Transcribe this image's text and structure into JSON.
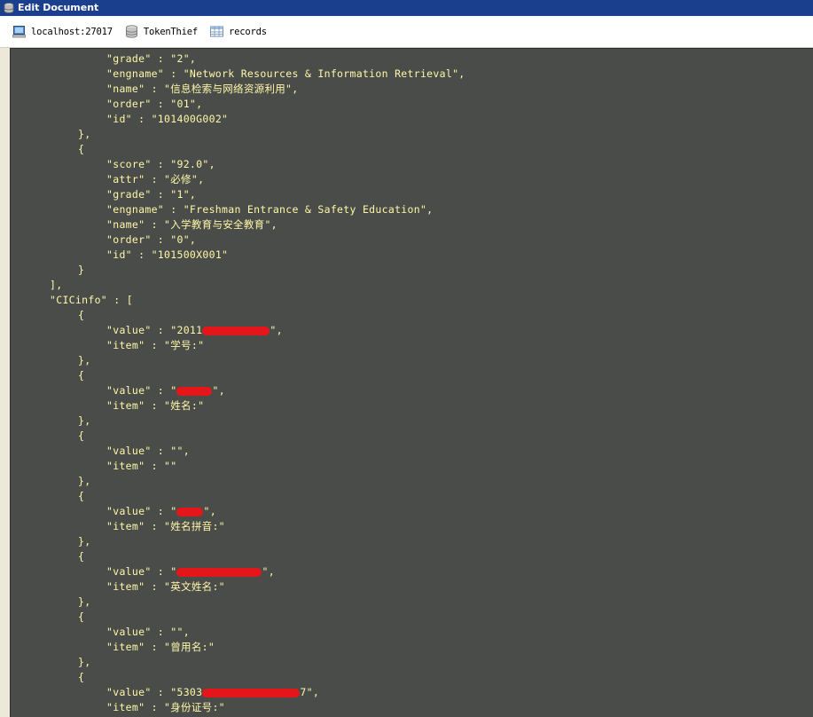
{
  "window": {
    "title": "Edit Document"
  },
  "breadcrumb": [
    {
      "label": "localhost:27017",
      "icon": "server-icon"
    },
    {
      "label": "TokenThief",
      "icon": "database-icon"
    },
    {
      "label": "records",
      "icon": "table-icon"
    }
  ],
  "document": {
    "lines": [
      {
        "indent": 12,
        "key": "\"grade\"",
        "value": "\"2\","
      },
      {
        "indent": 12,
        "key": "\"engname\"",
        "value": "\"Network Resources & Information Retrieval\","
      },
      {
        "indent": 12,
        "key": "\"name\"",
        "value": "\"信息检索与网络资源利用\","
      },
      {
        "indent": 12,
        "key": "\"order\"",
        "value": "\"01\","
      },
      {
        "indent": 12,
        "key": "\"id\"",
        "value": "\"101400G002\""
      },
      {
        "indent": 8,
        "text": "},"
      },
      {
        "indent": 8,
        "text": "{"
      },
      {
        "indent": 12,
        "key": "\"score\"",
        "value": "\"92.0\","
      },
      {
        "indent": 12,
        "key": "\"attr\"",
        "value": "\"必修\","
      },
      {
        "indent": 12,
        "key": "\"grade\"",
        "value": "\"1\","
      },
      {
        "indent": 12,
        "key": "\"engname\"",
        "value": "\"Freshman Entrance & Safety Education\","
      },
      {
        "indent": 12,
        "key": "\"name\"",
        "value": "\"入学教育与安全教育\","
      },
      {
        "indent": 12,
        "key": "\"order\"",
        "value": "\"0\","
      },
      {
        "indent": 12,
        "key": "\"id\"",
        "value": "\"101500X001\""
      },
      {
        "indent": 8,
        "text": "}"
      },
      {
        "indent": 4,
        "text": "],"
      },
      {
        "indent": 4,
        "key": "\"CICinfo\"",
        "value": "["
      },
      {
        "indent": 8,
        "text": "{"
      },
      {
        "indent": 12,
        "key": "\"value\"",
        "value": "\"2011",
        "redact": 76,
        "after": "\","
      },
      {
        "indent": 12,
        "key": "\"item\"",
        "value": "\"学号:\""
      },
      {
        "indent": 8,
        "text": "},"
      },
      {
        "indent": 8,
        "text": "{"
      },
      {
        "indent": 12,
        "key": "\"value\"",
        "value": "\"",
        "redact": 40,
        "after": "\","
      },
      {
        "indent": 12,
        "key": "\"item\"",
        "value": "\"姓名:\""
      },
      {
        "indent": 8,
        "text": "},"
      },
      {
        "indent": 8,
        "text": "{"
      },
      {
        "indent": 12,
        "key": "\"value\"",
        "value": "\"\","
      },
      {
        "indent": 12,
        "key": "\"item\"",
        "value": "\"\""
      },
      {
        "indent": 8,
        "text": "},"
      },
      {
        "indent": 8,
        "text": "{"
      },
      {
        "indent": 12,
        "key": "\"value\"",
        "value": "\"",
        "redact": 30,
        "after": "\","
      },
      {
        "indent": 12,
        "key": "\"item\"",
        "value": "\"姓名拼音:\""
      },
      {
        "indent": 8,
        "text": "},"
      },
      {
        "indent": 8,
        "text": "{"
      },
      {
        "indent": 12,
        "key": "\"value\"",
        "value": "\"",
        "redact": 96,
        "after": "\","
      },
      {
        "indent": 12,
        "key": "\"item\"",
        "value": "\"英文姓名:\""
      },
      {
        "indent": 8,
        "text": "},"
      },
      {
        "indent": 8,
        "text": "{"
      },
      {
        "indent": 12,
        "key": "\"value\"",
        "value": "\"\","
      },
      {
        "indent": 12,
        "key": "\"item\"",
        "value": "\"曾用名:\""
      },
      {
        "indent": 8,
        "text": "},"
      },
      {
        "indent": 8,
        "text": "{"
      },
      {
        "indent": 12,
        "key": "\"value\"",
        "value": "\"5303",
        "redact": 110,
        "after": "7\","
      },
      {
        "indent": 12,
        "key": "\"item\"",
        "value": "\"身份证号:\""
      }
    ]
  },
  "colors": {
    "editor_bg": "#4a4c49",
    "code_text": "#fff8a8",
    "redaction": "#e5161a",
    "titlebar": "#1a3f8c"
  }
}
